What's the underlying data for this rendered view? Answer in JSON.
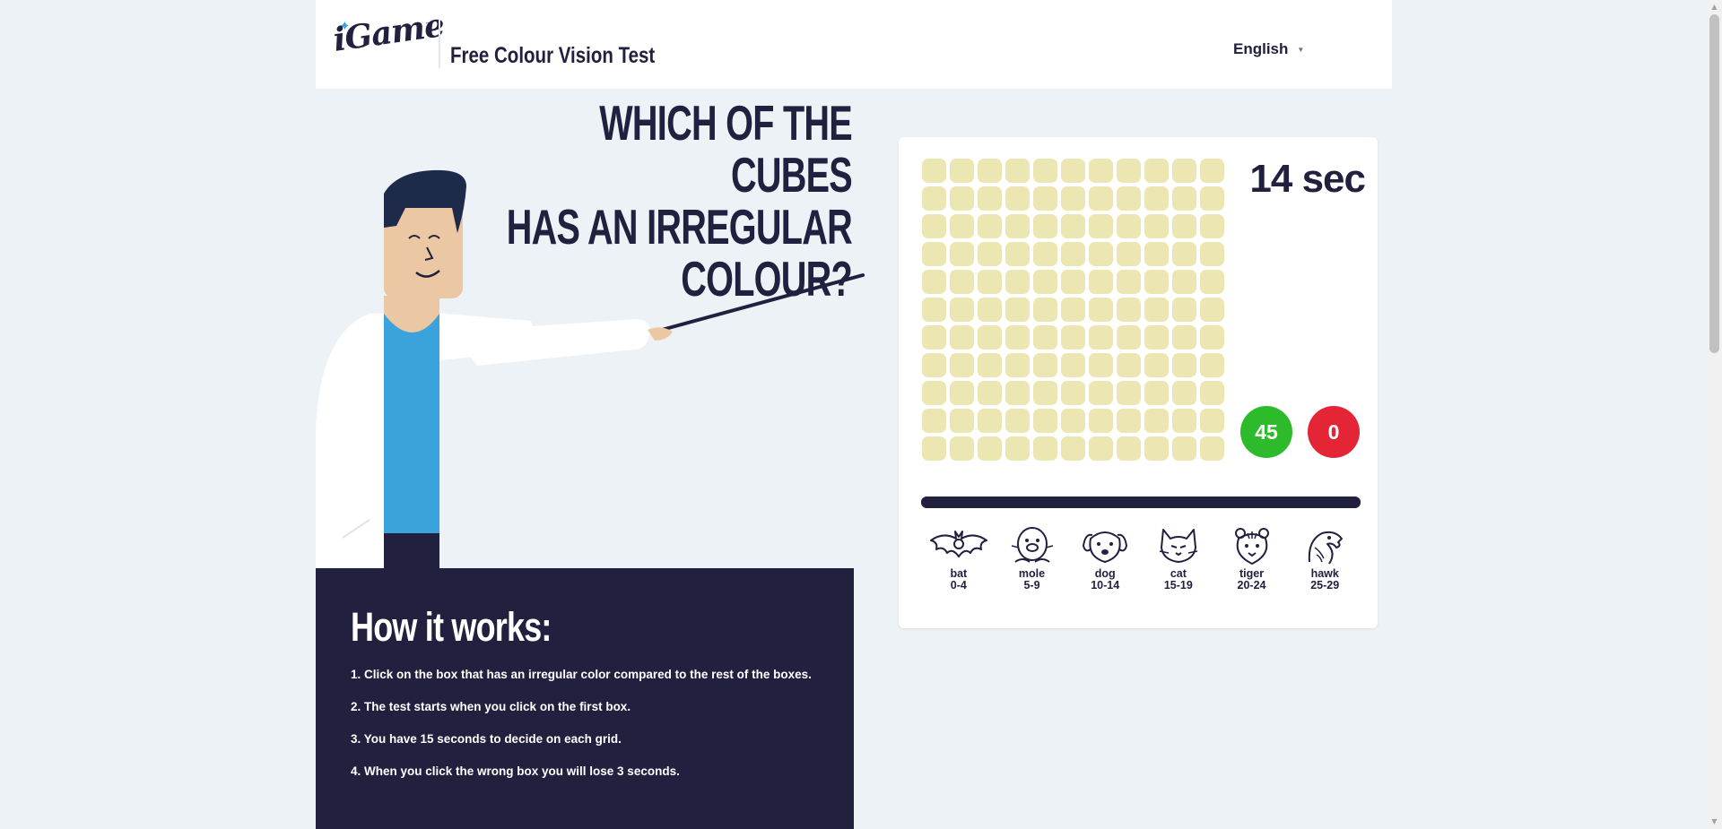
{
  "header": {
    "logo_text": "iGame",
    "logo_tm": "™",
    "title": "Free Colour Vision Test",
    "language": "English"
  },
  "question": {
    "line1": "WHICH OF THE CUBES",
    "line2": "HAS AN IRREGULAR",
    "line3": "COLOUR?"
  },
  "how_it_works": {
    "heading": "How it works:",
    "steps": [
      "1. Click on the box that has an irregular color compared to the rest of the boxes.",
      "2. The test starts when you click on the first box.",
      "3. You have 15 seconds to decide on each grid.",
      "4. When you click the wrong box you will lose 3 seconds."
    ]
  },
  "game": {
    "grid_rows": 11,
    "grid_cols": 11,
    "cell_color": "#ebe6b2",
    "timer": "14 sec",
    "score_correct": "45",
    "score_wrong": "0",
    "correct_color": "#2dbb2c",
    "wrong_color": "#e42536",
    "time_remaining_fraction": 1.0
  },
  "animals": [
    {
      "icon": "bat-icon",
      "name": "bat",
      "range": "0-4"
    },
    {
      "icon": "mole-icon",
      "name": "mole",
      "range": "5-9"
    },
    {
      "icon": "dog-icon",
      "name": "dog",
      "range": "10-14"
    },
    {
      "icon": "cat-icon",
      "name": "cat",
      "range": "15-19"
    },
    {
      "icon": "tiger-icon",
      "name": "tiger",
      "range": "20-24"
    },
    {
      "icon": "hawk-icon",
      "name": "hawk",
      "range": "25-29"
    }
  ],
  "colors": {
    "navy": "#22203f",
    "background": "#edf2f7",
    "skin": "#ecc7a4",
    "shirt": "#3aa3dc"
  }
}
